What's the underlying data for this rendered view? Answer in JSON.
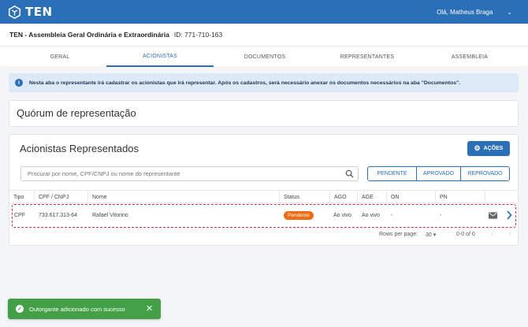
{
  "header": {
    "logo_text": "TEN",
    "user_greeting": "Olá, Matheus Braga",
    "user_chevron": "⌄",
    "bg_color": "#2a6fb7"
  },
  "title": {
    "name": "TEN - Assembleia Geral Ordinária e Extraordinária",
    "id": "ID: 771-710-163"
  },
  "tabs": [
    {
      "label": "GERAL",
      "active": false
    },
    {
      "label": "ACIONISTAS",
      "active": true
    },
    {
      "label": "DOCUMENTOS",
      "active": false
    },
    {
      "label": "REPRESENTANTES",
      "active": false
    },
    {
      "label": "ASSEMBLEIA",
      "active": false
    }
  ],
  "info": {
    "icon": "i",
    "text": "Nesta aba o representante irá cadastrar os acionistas que irá representar. Após os cadastros, será necessário anexar os documentos necessários na aba \"Documentos\"."
  },
  "quorum": {
    "title": "Quórum de representação"
  },
  "acionistas": {
    "title": "Acionistas Representados",
    "acoes_label": "AÇÕES",
    "search_placeholder": "Procurar por nome, CPF/CNPJ ou nome do representante",
    "filters": [
      "PENDENTE",
      "APROVADO",
      "REPROVADO"
    ],
    "columns": [
      "Tipo",
      "CPF / CNPJ",
      "Nome",
      "Status",
      "AGO",
      "AGE",
      "ON",
      "PN"
    ],
    "rows": [
      {
        "tipo": "CPF",
        "documento": "733.617.313-64",
        "nome": "Rafael Vitorino",
        "status": "Pendente",
        "ago": "Ao vivo",
        "age": "Ao vivo",
        "on": "-",
        "pn": "-"
      }
    ],
    "pagination": {
      "rows_per_page_label": "Rows per page:",
      "rows_per_page_value": "30",
      "range": "0-0 of 0"
    }
  },
  "toast": {
    "message": "Outorgante adicionado com sucesso",
    "close": "✕",
    "color": "#43a047"
  },
  "colors": {
    "accent": "#2a6fb7",
    "pending": "#ee6b14",
    "highlight_border": "#d22a4a"
  }
}
